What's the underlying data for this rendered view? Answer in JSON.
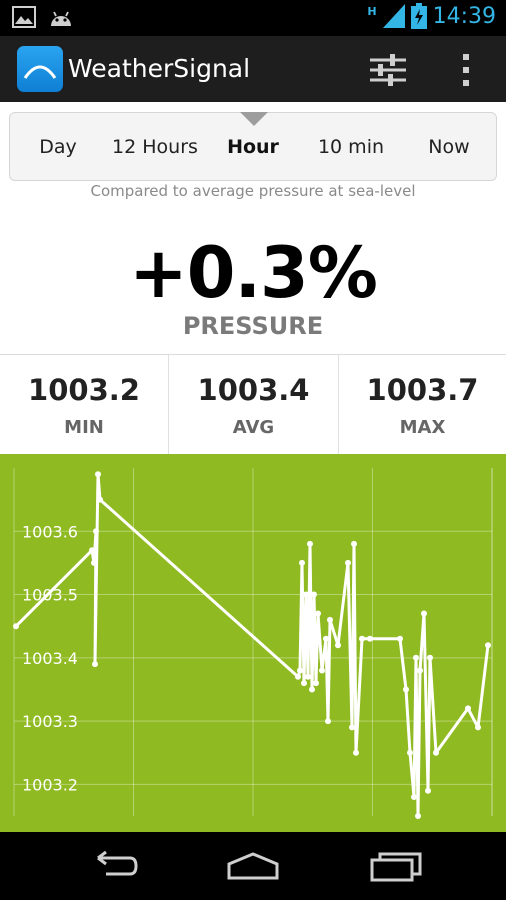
{
  "status_bar": {
    "time": "14:39",
    "network_type": "H",
    "icons": [
      "image-icon",
      "android-icon",
      "signal-icon",
      "battery-charging-icon"
    ]
  },
  "app": {
    "title": "WeatherSignal",
    "icon": "weather-arc-icon",
    "actions": [
      "settings-sliders-icon",
      "overflow-menu-icon"
    ]
  },
  "time_range": {
    "options": [
      "Day",
      "12 Hours",
      "Hour",
      "10 min",
      "Now"
    ],
    "selected": "Hour"
  },
  "comparison_note": "Compared to average pressure at sea-level",
  "reading": {
    "value": "+0.3%",
    "label": "PRESSURE"
  },
  "stats": [
    {
      "value": "1003.2",
      "label": "MIN"
    },
    {
      "value": "1003.4",
      "label": "AVG"
    },
    {
      "value": "1003.7",
      "label": "MAX"
    }
  ],
  "colors": {
    "chart_background": "#8fba22",
    "chart_line": "#ffffff",
    "accent": "#33b5e5"
  },
  "chart_data": {
    "type": "line",
    "title": "",
    "xlabel": "",
    "ylabel": "",
    "y_ticks": [
      "1003.6",
      "1003.5",
      "1003.4",
      "1003.3",
      "1003.2"
    ],
    "ylim": [
      1003.15,
      1003.7
    ],
    "grid": true,
    "series": [
      {
        "values": [
          1003.45,
          1003.57,
          1003.55,
          1003.6,
          1003.39,
          1003.69,
          1003.65,
          1003.37,
          1003.38,
          1003.55,
          1003.36,
          1003.5,
          1003.37,
          1003.58,
          1003.35,
          1003.5,
          1003.36,
          1003.47,
          1003.38,
          1003.43,
          1003.3,
          1003.46,
          1003.42,
          1003.55,
          1003.29,
          1003.58,
          1003.25,
          1003.43,
          1003.43,
          1003.43,
          1003.35,
          1003.25,
          1003.18,
          1003.4,
          1003.15,
          1003.38,
          1003.47,
          1003.19,
          1003.4,
          1003.25,
          1003.32,
          1003.29,
          1003.42
        ]
      }
    ]
  },
  "nav_bar": [
    "back-icon",
    "home-icon",
    "recent-apps-icon"
  ]
}
